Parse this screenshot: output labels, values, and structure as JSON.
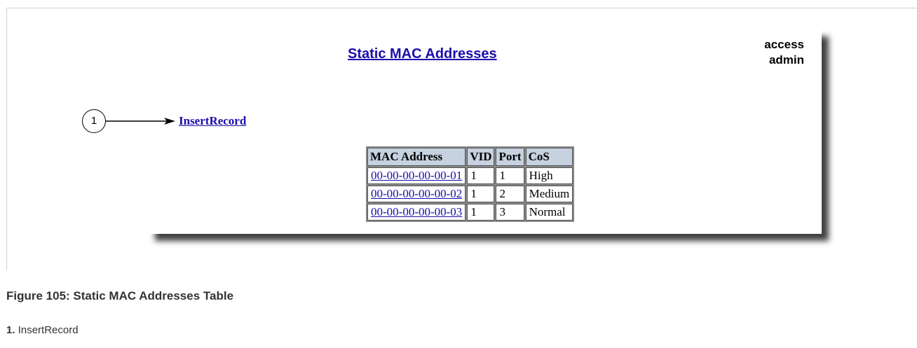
{
  "screen": {
    "title": "Static MAC Addresses",
    "access_label": "access",
    "access_user": "admin",
    "insert_link": "InsertRecord",
    "table": {
      "headers": [
        "MAC Address",
        "VID",
        "Port",
        "CoS"
      ],
      "rows": [
        {
          "mac": "00-00-00-00-00-01",
          "vid": "1",
          "port": "1",
          "cos": "High"
        },
        {
          "mac": "00-00-00-00-00-02",
          "vid": "1",
          "port": "2",
          "cos": "Medium"
        },
        {
          "mac": "00-00-00-00-00-03",
          "vid": "1",
          "port": "3",
          "cos": "Normal"
        }
      ]
    }
  },
  "callout": {
    "number": "1"
  },
  "figure": {
    "caption": "Figure 105: Static MAC Addresses Table",
    "note_number": "1.",
    "note_text": "InsertRecord"
  }
}
